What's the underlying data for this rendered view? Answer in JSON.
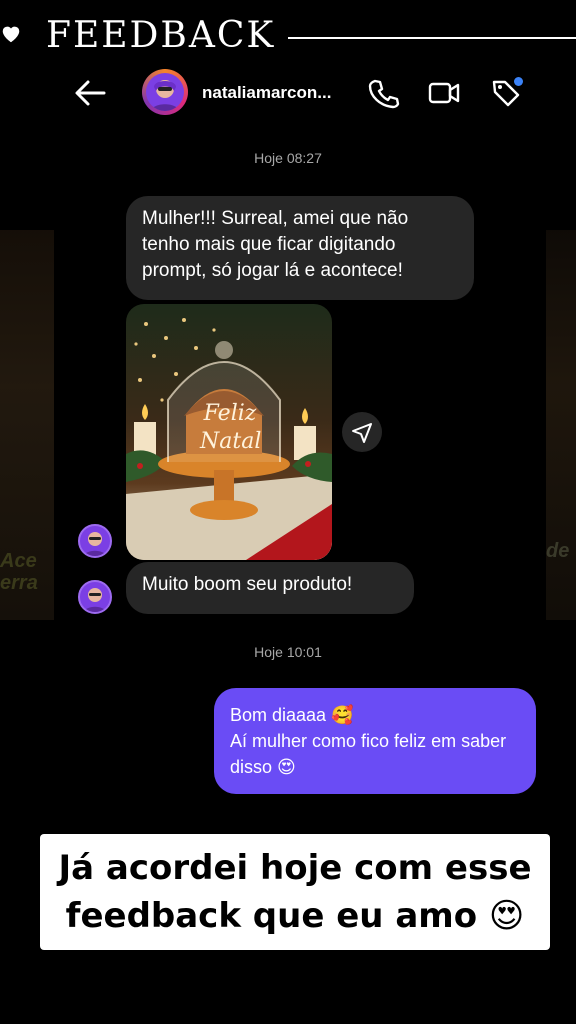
{
  "banner": {
    "title": "FEEDBACK"
  },
  "header": {
    "back_icon": "arrow-left-icon",
    "username": "nataliamarcon...",
    "icons": [
      "phone-icon",
      "video-icon",
      "tag-icon"
    ],
    "notification_color": "#3b82f6"
  },
  "side": {
    "left_text": "Ace\nerra",
    "right_text": "de"
  },
  "messages": {
    "timestamp1": "Hoje 08:27",
    "msg1": "Mulher!!! Surreal, amei que não tenho mais que ficar digitando prompt, só jogar lá e acontece!",
    "image": {
      "text_line1": "Feliz",
      "text_line2": "Natal",
      "share_icon": "send-icon"
    },
    "msg2": "Muito boom seu produto!",
    "timestamp2": "Hoje 10:01",
    "reply_line1": "Bom diaaaa 🥰",
    "reply_line2": "Aí mulher como fico feliz em saber disso 😍"
  },
  "caption": {
    "text": "Já acordei hoje com esse feedback que eu amo 😍"
  },
  "colors": {
    "outgoing_bubble": "#6a4cf5",
    "incoming_bubble": "#262626",
    "background": "#000000"
  }
}
